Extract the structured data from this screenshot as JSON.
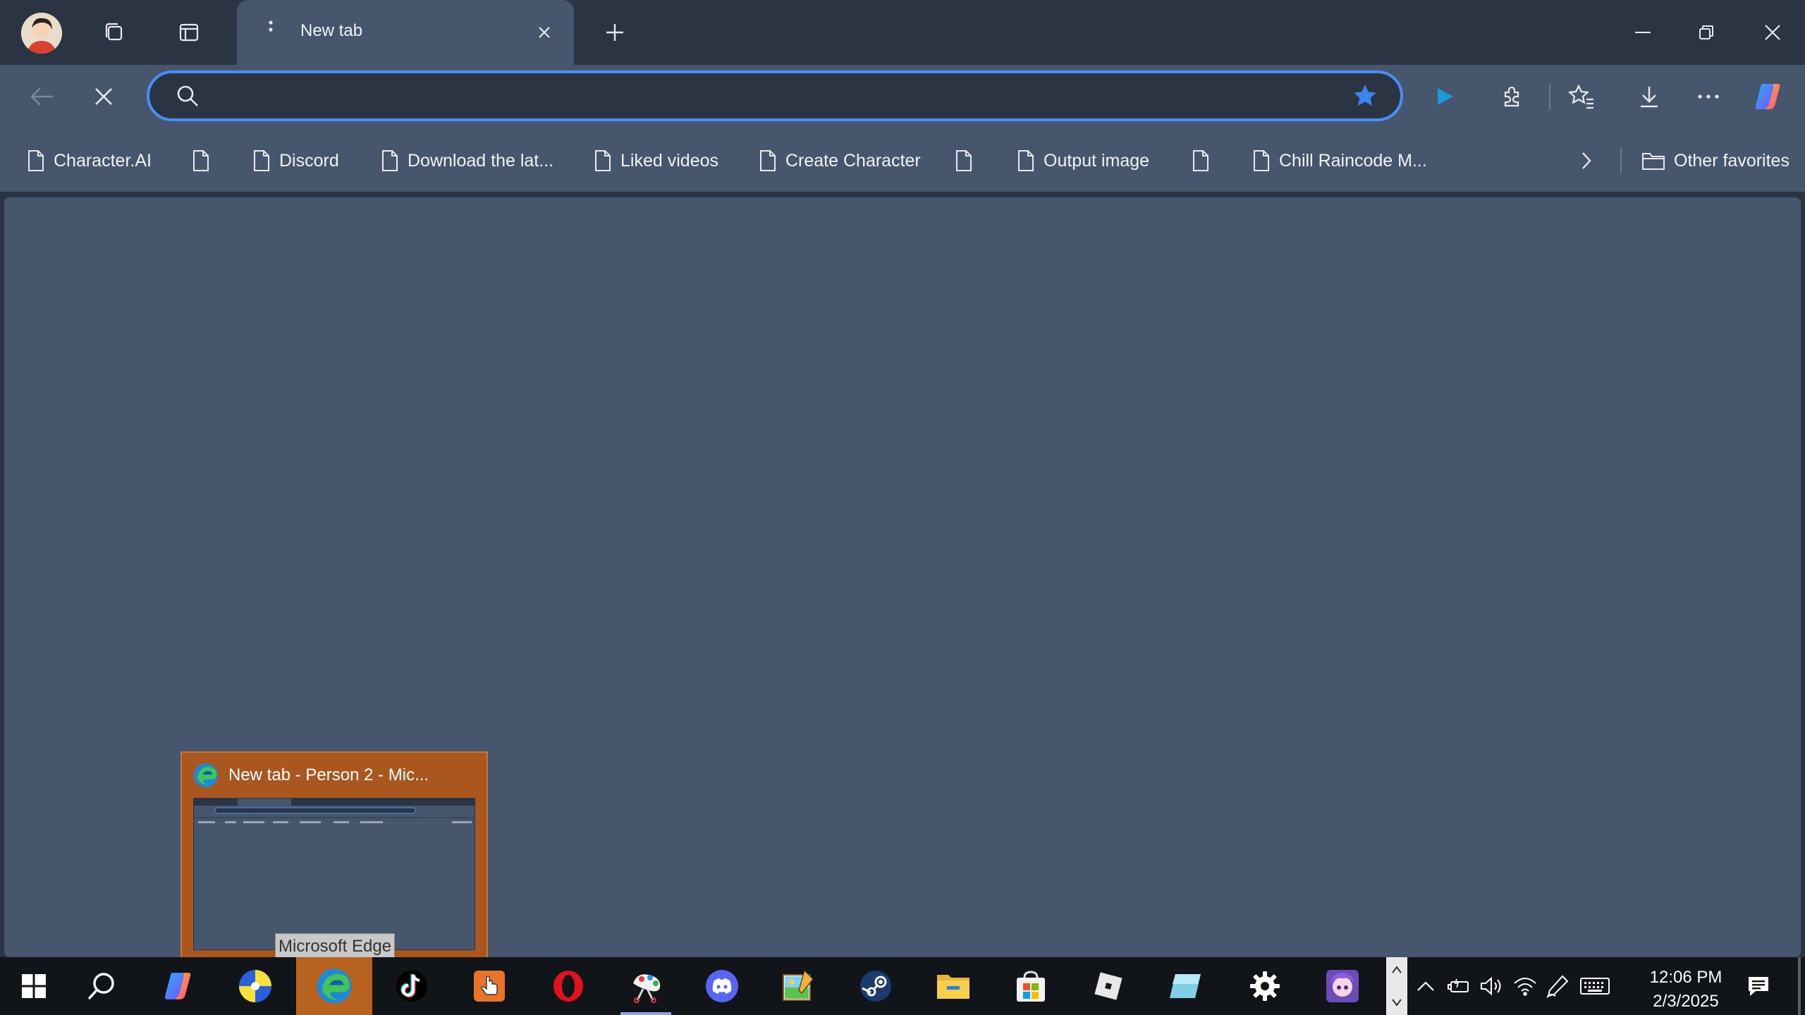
{
  "tab": {
    "title": "New tab"
  },
  "omnibox": {
    "value": ""
  },
  "favorites": [
    {
      "label": "Character.AI"
    },
    {
      "label": ""
    },
    {
      "label": "Discord"
    },
    {
      "label": "Download the lat..."
    },
    {
      "label": "Liked videos"
    },
    {
      "label": "Create Character"
    },
    {
      "label": ""
    },
    {
      "label": "Output image"
    },
    {
      "label": ""
    },
    {
      "label": "Chill Raincode M..."
    }
  ],
  "other_favorites": "Other favorites",
  "thumbnail": {
    "title": "New tab - Person 2 - Mic...",
    "tooltip": "Microsoft Edge"
  },
  "clock": {
    "time": "12:06 PM",
    "date": "2/3/2025"
  },
  "colors": {
    "accent": "#4b8df8",
    "tab_active": "#46566c",
    "taskbar_active": "#b8621f"
  }
}
